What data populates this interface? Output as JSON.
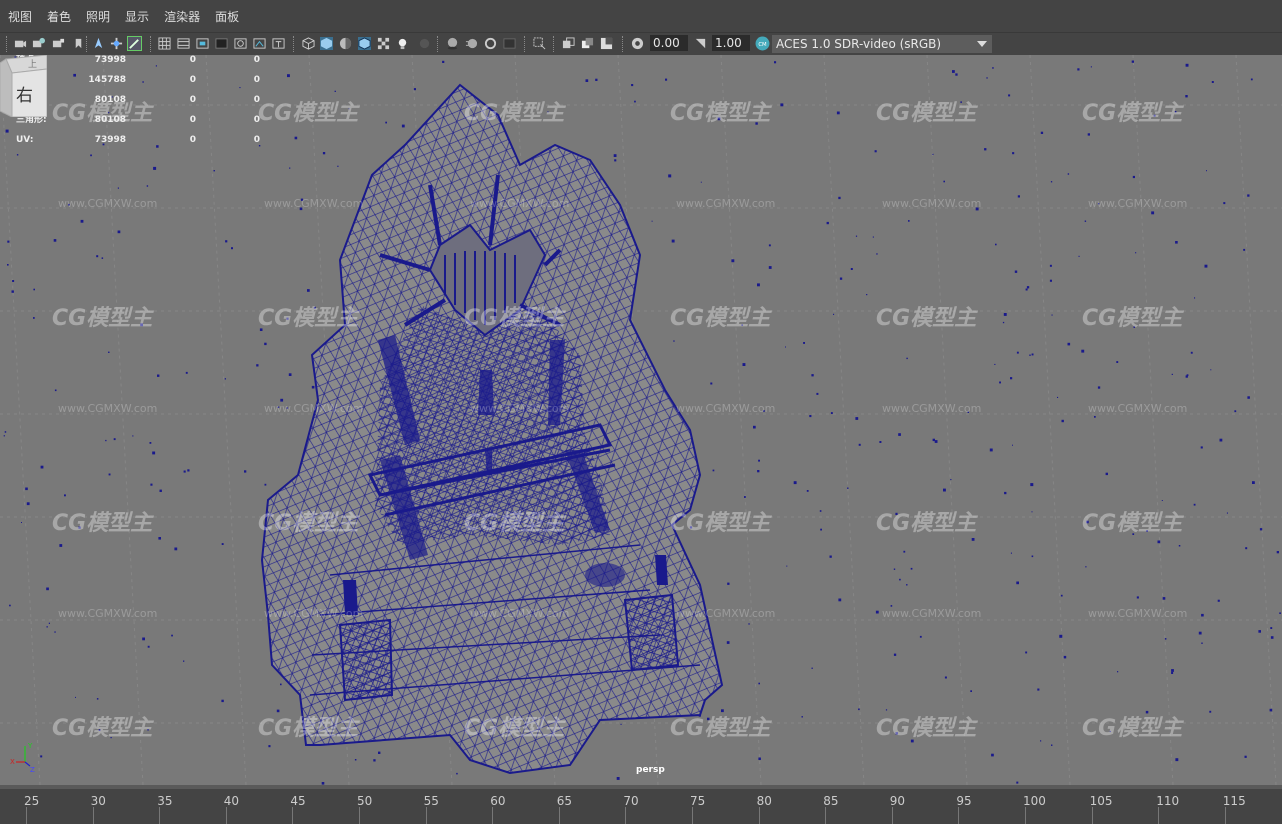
{
  "menu": [
    {
      "label": "视图"
    },
    {
      "label": "着色"
    },
    {
      "label": "照明"
    },
    {
      "label": "显示"
    },
    {
      "label": "渲染器"
    },
    {
      "label": "面板"
    }
  ],
  "toolbar": {
    "icons": [
      "camera-icon",
      "camera-attr-icon",
      "bookmark-icon",
      "bookmark2-icon",
      "move-icon",
      "paint-icon",
      "grid-icon",
      "film-gate-icon",
      "resolution-gate-icon",
      "gate-mask-icon",
      "field-chart-icon",
      "safe-action-icon",
      "safe-title-icon",
      "wireframe-icon",
      "smooth-shade-icon",
      "shade-wire-icon",
      "wire-on-shaded-icon",
      "textured-icon",
      "lights-icon",
      "shadows-icon",
      "screen-space-ao-icon",
      "motion-blur-icon",
      "anti-alias-icon",
      "depth-of-field-icon",
      "isolate-icon",
      "xray-icon",
      "xray-joints-icon",
      "xray-comp-icon",
      "exposure-icon",
      "gamma-icon",
      "colorspace-icon"
    ],
    "exposure_value": "0.00",
    "gamma_value": "1.00",
    "color_space": "ACES 1.0 SDR-video (sRGB)"
  },
  "hud": [
    {
      "label": "顶点:",
      "v1": "73998",
      "v2": "0",
      "v3": "0"
    },
    {
      "label": "边:",
      "v1": "145788",
      "v2": "0",
      "v3": "0"
    },
    {
      "label": "面:",
      "v1": "80108",
      "v2": "0",
      "v3": "0"
    },
    {
      "label": "三角形:",
      "v1": "80108",
      "v2": "0",
      "v3": "0"
    },
    {
      "label": "UV:",
      "v1": "73998",
      "v2": "0",
      "v3": "0"
    }
  ],
  "viewcube": {
    "top_face": "上",
    "side_face": "右"
  },
  "watermark": {
    "logo": "CG模型主",
    "url": "www.CGMXW.com"
  },
  "camera_label": "persp",
  "timeline": {
    "ticks": [
      "25",
      "30",
      "35",
      "40",
      "45",
      "50",
      "55",
      "60",
      "65",
      "70",
      "75",
      "80",
      "85",
      "90",
      "95",
      "100",
      "105",
      "110",
      "115"
    ]
  },
  "colors": {
    "wire": "#1a1a8c",
    "viewport_bg": "#797979",
    "mesh_fill": "#8a8a8a",
    "ui_bg": "#444444"
  }
}
